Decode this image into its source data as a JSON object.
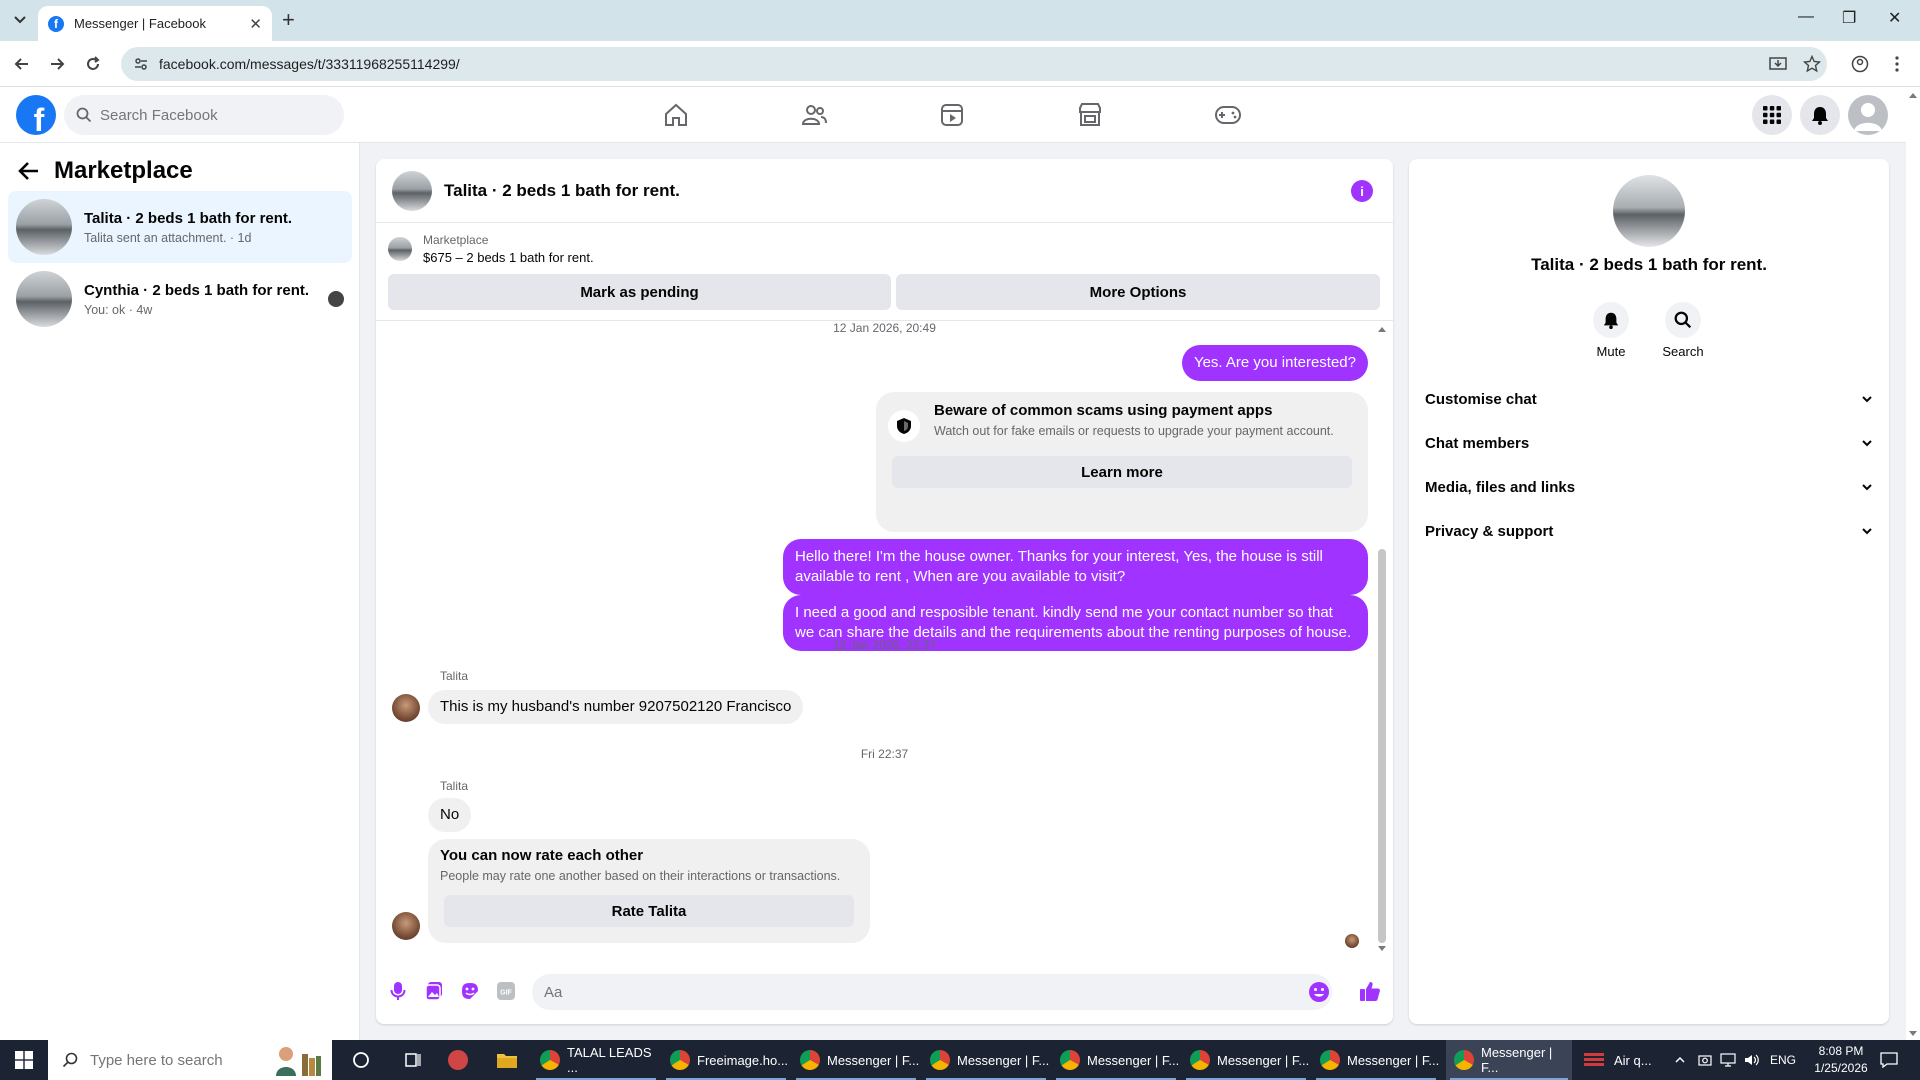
{
  "browser": {
    "tab_title": "Messenger | Facebook",
    "url": "facebook.com/messages/t/33311968255114299/"
  },
  "fb": {
    "search_placeholder": "Search Facebook"
  },
  "left": {
    "title": "Marketplace",
    "conversations": [
      {
        "name": "Talita · 2 beds 1 bath for rent.",
        "sub": "Talita sent an attachment. · 1d"
      },
      {
        "name": "Cynthia · 2 beds 1 bath for rent.",
        "sub": "You: ok · 4w"
      }
    ]
  },
  "chat": {
    "title": "Talita · 2 beds 1 bath for rent.",
    "marketplace_label": "Marketplace",
    "listing": "$675 – 2 beds 1 bath for rent.",
    "mark_pending": "Mark as pending",
    "more_options": "More Options",
    "stamp1": "12 Jan 2026, 20:49",
    "msg_out1": "Yes. Are you interested?",
    "scam_title": "Beware of common scams using payment apps",
    "scam_desc": "Watch out for fake emails or requests to upgrade your payment account.",
    "learn_more": "Learn more",
    "msg_out2": "Hello there! I'm the house owner. Thanks for your interest, Yes, the house is still available to rent , When are you available to visit?",
    "msg_out3": "I need a good and resposible tenant.  kindly send me your contact number so that we can share the details and the requirements about the renting purposes of house.",
    "stamp2": "12 Jan 2026, 22:37",
    "sender1": "Talita",
    "msg_in1": "This is my husband's number 9207502120 Francisco",
    "stamp3": "Fri 22:37",
    "sender2": "Talita",
    "msg_in2": "No",
    "rate_title": "You can now rate each other",
    "rate_desc": "People may rate one another based on their interactions or transactions.",
    "rate_button": "Rate Talita",
    "input_placeholder": "Aa"
  },
  "right": {
    "name": "Talita · 2 beds 1 bath for rent.",
    "mute": "Mute",
    "search": "Search",
    "sections": [
      "Customise chat",
      "Chat members",
      "Media, files and links",
      "Privacy & support"
    ]
  },
  "taskbar": {
    "search_placeholder": "Type here to search",
    "apps": [
      {
        "label": "TALAL LEADS ..."
      },
      {
        "label": "Freeimage.ho..."
      },
      {
        "label": "Messenger | F..."
      },
      {
        "label": "Messenger | F..."
      },
      {
        "label": "Messenger | F..."
      },
      {
        "label": "Messenger | F..."
      },
      {
        "label": "Messenger | F..."
      },
      {
        "label": "Messenger | F..."
      }
    ],
    "weather": "Air q...",
    "lang": "ENG",
    "time": "8:08 PM",
    "date": "1/25/2026"
  },
  "colors": {
    "accent": "#a033ff",
    "fb_blue": "#1877f2"
  }
}
